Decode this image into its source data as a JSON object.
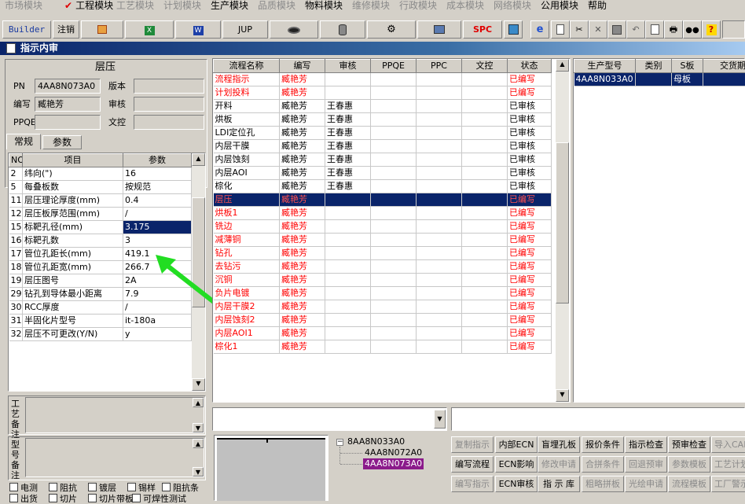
{
  "menu": [
    {
      "label": "市场模块",
      "enabled": false
    },
    {
      "label": "工程模块",
      "enabled": true,
      "checked": true
    },
    {
      "label": "工艺模块",
      "enabled": false
    },
    {
      "label": "计划模块",
      "enabled": false
    },
    {
      "label": "生产模块",
      "enabled": true
    },
    {
      "label": "品质模块",
      "enabled": false
    },
    {
      "label": "物料模块",
      "enabled": true
    },
    {
      "label": "维修模块",
      "enabled": false
    },
    {
      "label": "行政模块",
      "enabled": false
    },
    {
      "label": "成本模块",
      "enabled": false
    },
    {
      "label": "网络模块",
      "enabled": false
    },
    {
      "label": "公用模块",
      "enabled": true
    },
    {
      "label": "帮助",
      "enabled": true
    }
  ],
  "toolbar": {
    "builder": "Builder",
    "logout": "注销",
    "jup": "JUP",
    "spc": "SPC",
    "icons": [
      "orange-doc-icon",
      "excel-icon",
      "word-icon",
      "eye-icon",
      "database-icon",
      "gears-icon",
      "computer-icon",
      "calendar-icon",
      "ie-icon",
      "new-page-icon",
      "cut-icon",
      "delete-icon",
      "save-icon",
      "undo-icon",
      "print-preview-icon",
      "print-icon",
      "binoculars-icon",
      "help-icon"
    ]
  },
  "window_title": "指示内审",
  "left_panel": {
    "title": "层压",
    "pn_label": "PN",
    "pn_value": "4AA8N073A0",
    "version_label": "版本",
    "version_value": "",
    "author_label": "编写",
    "author_value": "臧艳芳",
    "review_label": "审核",
    "review_value": "",
    "ppqe_label": "PPQE",
    "ppqe_value": "",
    "doc_label": "文控",
    "doc_value": "",
    "tabs": [
      "常规",
      "参数"
    ],
    "param_headers": [
      "NO",
      "项目",
      "参数"
    ],
    "params": [
      {
        "no": "2",
        "item": "纬向(\")",
        "value": "16"
      },
      {
        "no": "5",
        "item": "每叠板数",
        "value": "按规范"
      },
      {
        "no": "11",
        "item": "层压理论厚度(mm)",
        "value": "0.4"
      },
      {
        "no": "12",
        "item": "层压板厚范围(mm)",
        "value": "/"
      },
      {
        "no": "15",
        "item": "标靶孔径(mm)",
        "value": "3.175",
        "selected": true
      },
      {
        "no": "16",
        "item": "标靶孔数",
        "value": "3"
      },
      {
        "no": "17",
        "item": "管位孔距长(mm)",
        "value": "419.1"
      },
      {
        "no": "18",
        "item": "管位孔距宽(mm)",
        "value": "266.7"
      },
      {
        "no": "19",
        "item": "层压图号",
        "value": "2A"
      },
      {
        "no": "29",
        "item": "钻孔到导体最小距离",
        "value": "7.9"
      },
      {
        "no": "30",
        "item": "RCC厚度",
        "value": "/"
      },
      {
        "no": "31",
        "item": "半固化片型号",
        "value": "it-180a"
      },
      {
        "no": "32",
        "item": "层压不可更改(Y/N)",
        "value": "y"
      }
    ],
    "craft_note_label": "工艺备注",
    "model_note_label": "型号备注",
    "checkboxes_row1": [
      "电测",
      "阻抗",
      "镀层",
      "锡样",
      "阻抗条"
    ],
    "checkboxes_row2": [
      "出货",
      "切片",
      "切片带板",
      "可焊性测试"
    ]
  },
  "process_table": {
    "headers": [
      "流程名称",
      "编写",
      "审核",
      "PPQE",
      "PPC",
      "文控",
      "状态"
    ],
    "rows": [
      {
        "name": "流程指示",
        "author": "臧艳芳",
        "reviewer": "",
        "status": "已编写",
        "red": true
      },
      {
        "name": "计划投料",
        "author": "臧艳芳",
        "reviewer": "",
        "status": "已编写",
        "red": true
      },
      {
        "name": "开料",
        "author": "臧艳芳",
        "reviewer": "王春惠",
        "status": "已审核",
        "red": false
      },
      {
        "name": "烘板",
        "author": "臧艳芳",
        "reviewer": "王春惠",
        "status": "已审核",
        "red": false
      },
      {
        "name": "LDI定位孔",
        "author": "臧艳芳",
        "reviewer": "王春惠",
        "status": "已审核",
        "red": false
      },
      {
        "name": "内层干膜",
        "author": "臧艳芳",
        "reviewer": "王春惠",
        "status": "已审核",
        "red": false
      },
      {
        "name": "内层蚀刻",
        "author": "臧艳芳",
        "reviewer": "王春惠",
        "status": "已审核",
        "red": false
      },
      {
        "name": "内层AOI",
        "author": "臧艳芳",
        "reviewer": "王春惠",
        "status": "已审核",
        "red": false
      },
      {
        "name": "棕化",
        "author": "臧艳芳",
        "reviewer": "王春惠",
        "status": "已审核",
        "red": false
      },
      {
        "name": "层压",
        "author": "臧艳芳",
        "reviewer": "",
        "status": "已编写",
        "red": true,
        "selected": true
      },
      {
        "name": "烘板1",
        "author": "臧艳芳",
        "reviewer": "",
        "status": "已编写",
        "red": true
      },
      {
        "name": "铣边",
        "author": "臧艳芳",
        "reviewer": "",
        "status": "已编写",
        "red": true
      },
      {
        "name": "减薄铜",
        "author": "臧艳芳",
        "reviewer": "",
        "status": "已编写",
        "red": true
      },
      {
        "name": "钻孔",
        "author": "臧艳芳",
        "reviewer": "",
        "status": "已编写",
        "red": true
      },
      {
        "name": "去钻污",
        "author": "臧艳芳",
        "reviewer": "",
        "status": "已编写",
        "red": true
      },
      {
        "name": "沉铜",
        "author": "臧艳芳",
        "reviewer": "",
        "status": "已编写",
        "red": true
      },
      {
        "name": "负片电镀",
        "author": "臧艳芳",
        "reviewer": "",
        "status": "已编写",
        "red": true
      },
      {
        "name": "内层干膜2",
        "author": "臧艳芳",
        "reviewer": "",
        "status": "已编写",
        "red": true
      },
      {
        "name": "内层蚀刻2",
        "author": "臧艳芳",
        "reviewer": "",
        "status": "已编写",
        "red": true
      },
      {
        "name": "内层AOI1",
        "author": "臧艳芳",
        "reviewer": "",
        "status": "已编写",
        "red": true
      },
      {
        "name": "棕化1",
        "author": "臧艳芳",
        "reviewer": "",
        "status": "已编写",
        "red": true
      }
    ]
  },
  "model_table": {
    "headers": [
      "生产型号",
      "类别",
      "S板",
      "交货期"
    ],
    "rows": [
      {
        "model": "4AA8N033A0",
        "category": "",
        "s_board": "母板",
        "delivery": ""
      }
    ]
  },
  "tree": {
    "root": "8AA8N033A0",
    "children": [
      "4AA8N072A0",
      "4AA8N073A0"
    ],
    "selected_index": 1
  },
  "buttons": [
    [
      {
        "label": "复制指示",
        "enabled": false
      },
      {
        "label": "内部ECN",
        "enabled": true
      },
      {
        "label": "盲埋孔板",
        "enabled": true
      },
      {
        "label": "报价条件",
        "enabled": true
      },
      {
        "label": "指示检查",
        "enabled": true
      },
      {
        "label": "预审检查",
        "enabled": true
      },
      {
        "label": "导入CAM",
        "enabled": false
      }
    ],
    [
      {
        "label": "编写流程",
        "enabled": true
      },
      {
        "label": "ECN影响",
        "enabled": true
      },
      {
        "label": "修改申请",
        "enabled": false
      },
      {
        "label": "合拼条件",
        "enabled": false
      },
      {
        "label": "回退预审",
        "enabled": false
      },
      {
        "label": "参数模板",
        "enabled": false
      },
      {
        "label": "工艺计划",
        "enabled": false
      }
    ],
    [
      {
        "label": "编写指示",
        "enabled": false
      },
      {
        "label": "ECN审核",
        "enabled": true
      },
      {
        "label": "指 示 库",
        "enabled": true
      },
      {
        "label": "粗略拼板",
        "enabled": false
      },
      {
        "label": "光绘申请",
        "enabled": false
      },
      {
        "label": "流程模板",
        "enabled": false
      },
      {
        "label": "工厂警示",
        "enabled": false
      }
    ]
  ],
  "colors": {
    "selection": "#0a246a",
    "red_text": "#ff0000",
    "annotation_arrow": "#22dd22",
    "window_bg": "#d4d0c8"
  }
}
